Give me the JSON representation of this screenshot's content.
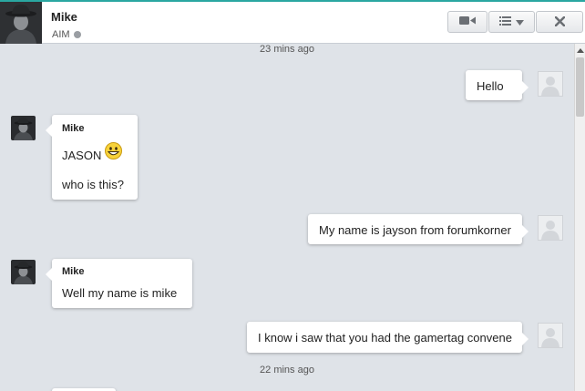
{
  "header": {
    "contact_name": "Mike",
    "status_label": "AIM",
    "status_color": "#9a9ea3",
    "accent_color": "#2aa7a1",
    "buttons": [
      {
        "name": "video-call-button",
        "icon": "video-camera-icon"
      },
      {
        "name": "options-menu-button",
        "icon": "list-icon"
      },
      {
        "name": "close-button",
        "icon": "close-icon"
      }
    ]
  },
  "chat": {
    "timestamp_1": "23 mins ago",
    "timestamp_2": "22 mins ago",
    "messages": [
      {
        "direction": "outgoing",
        "text": "Hello"
      },
      {
        "direction": "incoming",
        "sender": "Mike",
        "text": "JASON",
        "emoji": "grinning-face",
        "text_2": "who is this?"
      },
      {
        "direction": "outgoing",
        "text": "My name is jayson from forumkorner"
      },
      {
        "direction": "incoming",
        "sender": "Mike",
        "text": "Well my name is mike"
      },
      {
        "direction": "outgoing",
        "text": "I know i saw that you had the gamertag convene"
      }
    ]
  }
}
